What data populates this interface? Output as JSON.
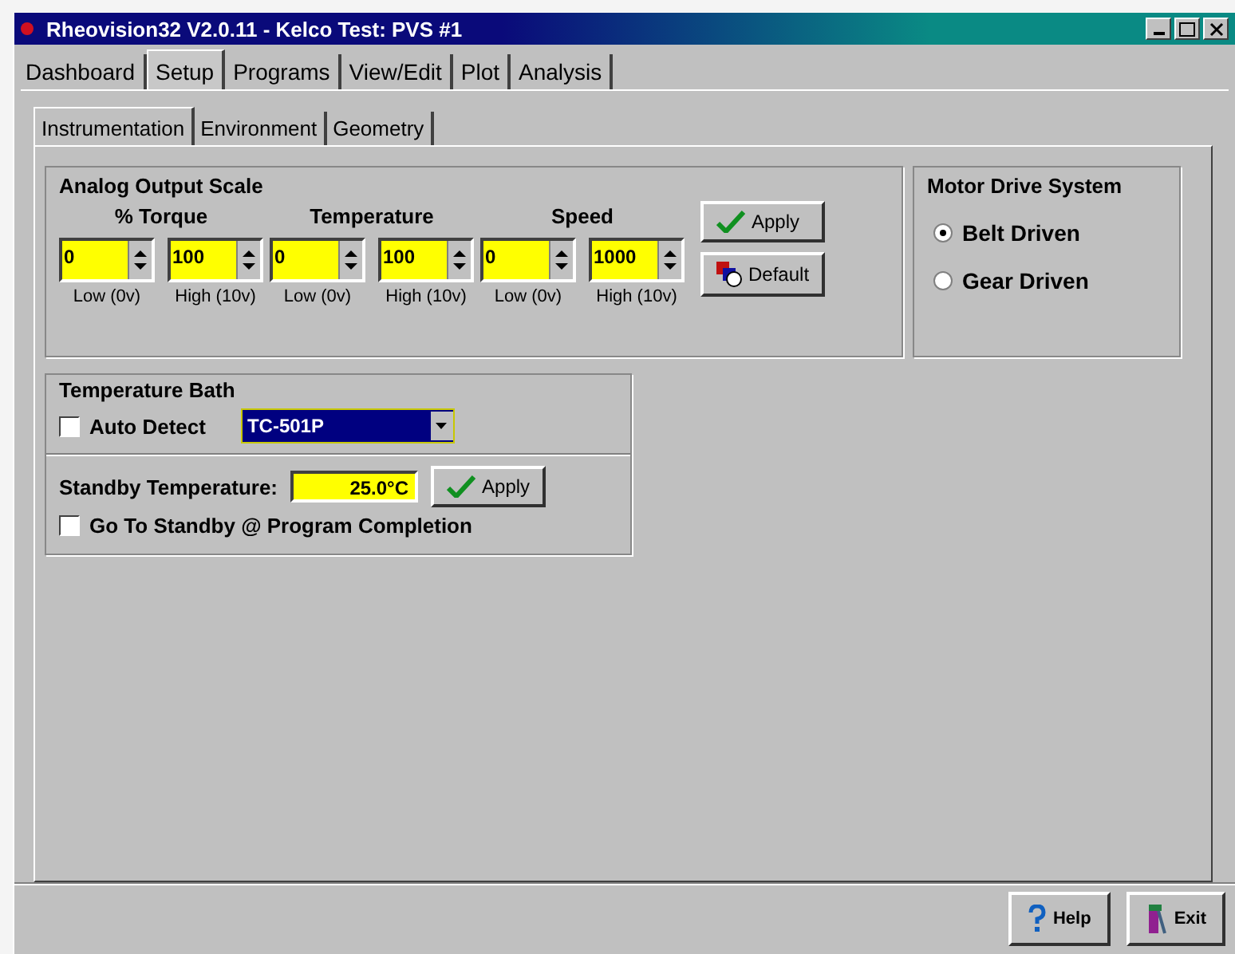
{
  "window": {
    "title": "Rheovision32 V2.0.11 - Kelco Test: PVS #1"
  },
  "tabs": [
    {
      "label": "Dashboard",
      "selected": false
    },
    {
      "label": "Setup",
      "selected": true
    },
    {
      "label": "Programs",
      "selected": false
    },
    {
      "label": "View/Edit",
      "selected": false
    },
    {
      "label": "Plot",
      "selected": false
    },
    {
      "label": "Analysis",
      "selected": false
    }
  ],
  "subtabs": [
    {
      "label": "Instrumentation",
      "selected": true
    },
    {
      "label": "Environment",
      "selected": false
    },
    {
      "label": "Geometry",
      "selected": false
    }
  ],
  "analog_output_scale": {
    "title": "Analog Output Scale",
    "groups": [
      {
        "label": "% Torque",
        "fields": [
          {
            "value": "0",
            "caption": "Low (0v)"
          },
          {
            "value": "100",
            "caption": "High (10v)"
          }
        ]
      },
      {
        "label": "Temperature",
        "fields": [
          {
            "value": "0",
            "caption": "Low (0v)"
          },
          {
            "value": "100",
            "caption": "High (10v)"
          }
        ]
      },
      {
        "label": "Speed",
        "fields": [
          {
            "value": "0",
            "caption": "Low (0v)"
          },
          {
            "value": "1000",
            "caption": "High (10v)"
          }
        ]
      }
    ],
    "buttons": [
      {
        "label": "Apply",
        "kind": "apply"
      },
      {
        "label": "Default",
        "kind": "default"
      }
    ]
  },
  "motor_drive": {
    "title": "Motor Drive System",
    "options": [
      {
        "label": "Belt Driven",
        "selected": true
      },
      {
        "label": "Gear Driven",
        "selected": false
      }
    ]
  },
  "temperature_bath": {
    "title": "Temperature Bath",
    "auto_detect": {
      "label": "Auto Detect",
      "checked": false
    },
    "controller": "TC-501P",
    "standby_label": "Standby Temperature:",
    "standby_value": "25.0°C",
    "apply": {
      "label": "Apply",
      "kind": "apply"
    },
    "go_standby": {
      "label": "Go To Standby @ Program Completion",
      "checked": false
    }
  },
  "footer_buttons": [
    {
      "label": "Help",
      "kind": "help"
    },
    {
      "label": "Exit",
      "kind": "exit"
    }
  ]
}
